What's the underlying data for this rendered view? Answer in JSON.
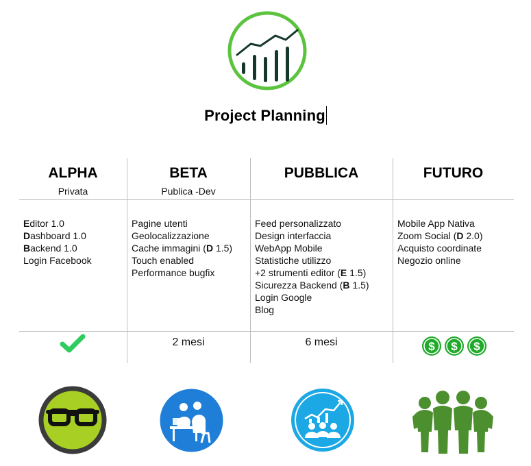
{
  "page": {
    "title": "Project Planning"
  },
  "logo": {
    "icon": "growth-chart-icon",
    "ring_color": "#5cc33e",
    "bar_color": "#15382a"
  },
  "columns": [
    {
      "name": "ALPHA",
      "subtitle": "Privata",
      "features": [
        {
          "bold": "E",
          "rest": "ditor 1.0"
        },
        {
          "bold": "D",
          "rest": "ashboard 1.0"
        },
        {
          "bold": "B",
          "rest": "ackend 1.0"
        },
        {
          "text": "Login Facebook"
        }
      ],
      "status_icon": "check-icon",
      "icon": "glasses-icon"
    },
    {
      "name": "BETA",
      "subtitle": "Publica -Dev",
      "features": [
        {
          "text": "Pagine utenti"
        },
        {
          "text": "Geolocalizzazione"
        },
        {
          "pre": "Cache immagini (",
          "bold": "D",
          "post": " 1.5)"
        },
        {
          "text": "Touch enabled"
        },
        {
          "text": "Performance bugfix"
        }
      ],
      "duration": "2 mesi",
      "icon": "team-at-desk-icon"
    },
    {
      "name": "PUBBLICA",
      "subtitle": "",
      "features": [
        {
          "text": "Feed personalizzato"
        },
        {
          "text": "Design interfaccia"
        },
        {
          "text": "WebApp Mobile"
        },
        {
          "text": "Statistiche utilizzo"
        },
        {
          "pre": "+2 strumenti editor  (",
          "bold": "E",
          "post": " 1.5)"
        },
        {
          "pre": "Sicurezza Backend (",
          "bold": "B",
          "post": " 1.5)"
        },
        {
          "text": "Login Google"
        },
        {
          "text": "Blog"
        }
      ],
      "duration": "6 mesi",
      "icon": "audience-growth-icon"
    },
    {
      "name": "FUTURO",
      "subtitle": "",
      "features": [
        {
          "text": "Mobile App Nativa"
        },
        {
          "pre": "Zoom Social (",
          "bold": "D",
          "post": " 2.0)"
        },
        {
          "text": "Acquisto coordinate"
        },
        {
          "text": "Negozio online"
        }
      ],
      "status_icon": "dollar-coins-icon",
      "icon": "people-group-icon"
    }
  ],
  "colors": {
    "check_green": "#2ecc5e",
    "money_green": "#1faa2a",
    "glasses_lime": "#a8cf24",
    "glasses_ring": "#3b3b3b",
    "beta_blue": "#1f7fd8",
    "pubblica_cyan": "#1ba8e4",
    "futuro_green": "#4c8f2f",
    "grid_line": "#bdbdbd"
  }
}
